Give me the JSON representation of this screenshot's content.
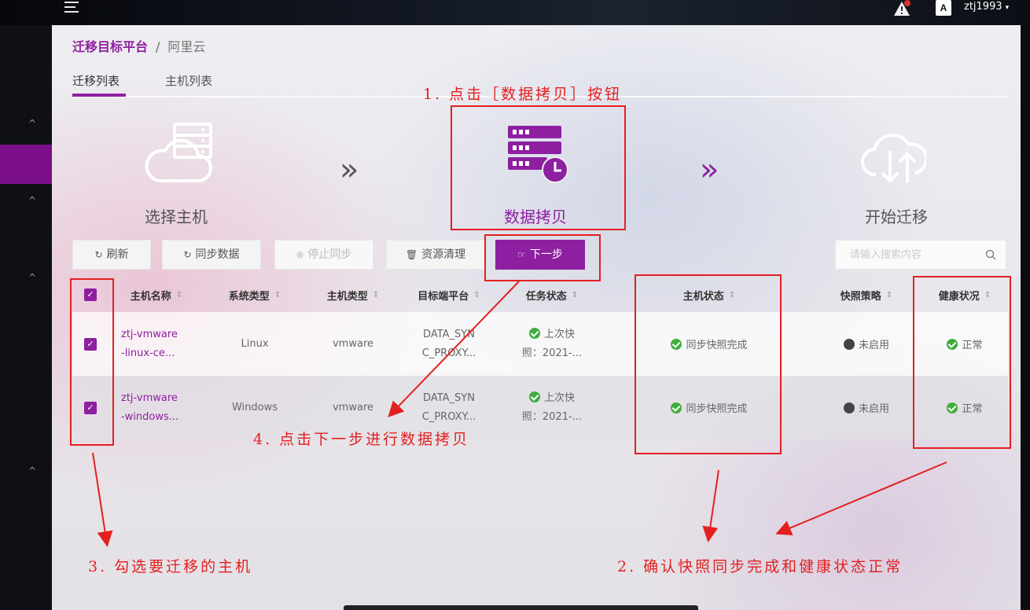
{
  "header": {
    "menu_icon": "hamburger-menu-icon",
    "alert_icon": "alert-triangle-icon",
    "font_icon_label": "A",
    "username": "ztj1993",
    "caret": "▾"
  },
  "sidebar": {
    "chevron": "^"
  },
  "breadcrumb": {
    "parent": "迁移目标平台",
    "separator": "/",
    "current": "阿里云"
  },
  "tabs": [
    {
      "label": "迁移列表",
      "active": true
    },
    {
      "label": "主机列表",
      "active": false
    }
  ],
  "steps": [
    {
      "label": "选择主机",
      "icon": "cloud-server-icon"
    },
    {
      "label": "数据拷贝",
      "icon": "database-clock-icon",
      "active": true
    },
    {
      "label": "开始迁移",
      "icon": "cloud-transfer-icon"
    }
  ],
  "step_arrow": "»",
  "toolbar": {
    "refresh": "刷新",
    "sync": "同步数据",
    "stop_sync": "停止同步",
    "cleanup": "资源清理",
    "next": "下一步",
    "search_placeholder": "请输入搜索内容"
  },
  "table": {
    "columns": [
      "主机名称",
      "系统类型",
      "主机类型",
      "目标端平台",
      "任务状态",
      "主机状态",
      "快照策略",
      "健康状况"
    ],
    "sort_icon": "⇕",
    "rows": [
      {
        "checked": true,
        "name_line1": "ztj-vmware",
        "name_line2": "-linux-ce...",
        "os": "Linux",
        "host_type": "vmware",
        "platform_line1": "DATA_SYN",
        "platform_line2": "C_PROXY...",
        "task_line1": "上次快",
        "task_line2": "照：2021-...",
        "host_status": "同步快照完成",
        "snapshot": "未启用",
        "health": "正常"
      },
      {
        "checked": true,
        "name_line1": "ztj-vmware",
        "name_line2": "-windows...",
        "os": "Windows",
        "host_type": "vmware",
        "platform_line1": "DATA_SYN",
        "platform_line2": "C_PROXY...",
        "task_line1": "上次快",
        "task_line2": "照：2021-...",
        "host_status": "同步快照完成",
        "snapshot": "未启用",
        "health": "正常"
      }
    ]
  },
  "annotations": {
    "step1": "1. 点击［数据拷贝］按钮",
    "step2": "2. 确认快照同步完成和健康状态正常",
    "step3": "3. 勾选要迁移的主机",
    "step4": "4. 点击下一步进行数据拷贝",
    "color": "#e41f1f"
  },
  "colors": {
    "accent": "#8e1fa0",
    "ok": "#3fae3f",
    "annotation": "#e41f1f"
  }
}
